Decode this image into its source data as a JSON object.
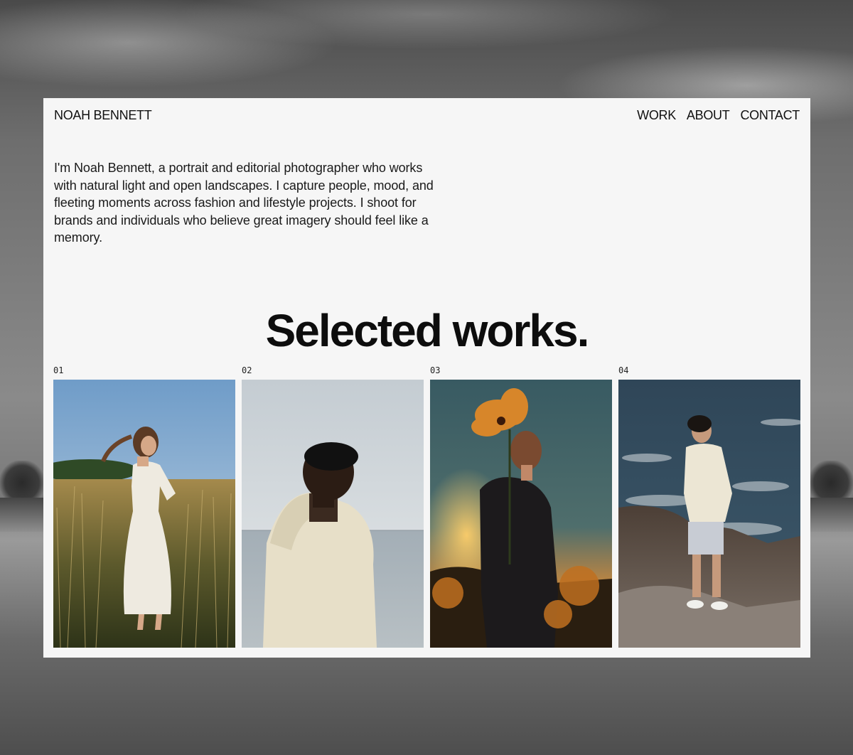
{
  "site": {
    "brand": "NOAH BENNETT"
  },
  "nav": {
    "items": [
      {
        "label": "WORK"
      },
      {
        "label": "ABOUT"
      },
      {
        "label": "CONTACT"
      }
    ]
  },
  "intro": {
    "text": "I'm Noah Bennett, a portrait and editorial photographer who works with natural light and open landscapes. I capture people, mood, and fleeting moments across fashion and lifestyle projects. I shoot for brands and individuals who believe great imagery should feel like a memory."
  },
  "works": {
    "heading": "Selected works.",
    "items": [
      {
        "number": "01",
        "image": "woman-in-white-dress-in-meadow-photo"
      },
      {
        "number": "02",
        "image": "man-in-hooded-jacket-by-sea-photo"
      },
      {
        "number": "03",
        "image": "woman-holding-poppy-at-sunset-photo"
      },
      {
        "number": "04",
        "image": "man-on-coastal-rocks-photo"
      }
    ]
  },
  "colors": {
    "card_background": "#f6f6f6",
    "text": "#111111"
  }
}
